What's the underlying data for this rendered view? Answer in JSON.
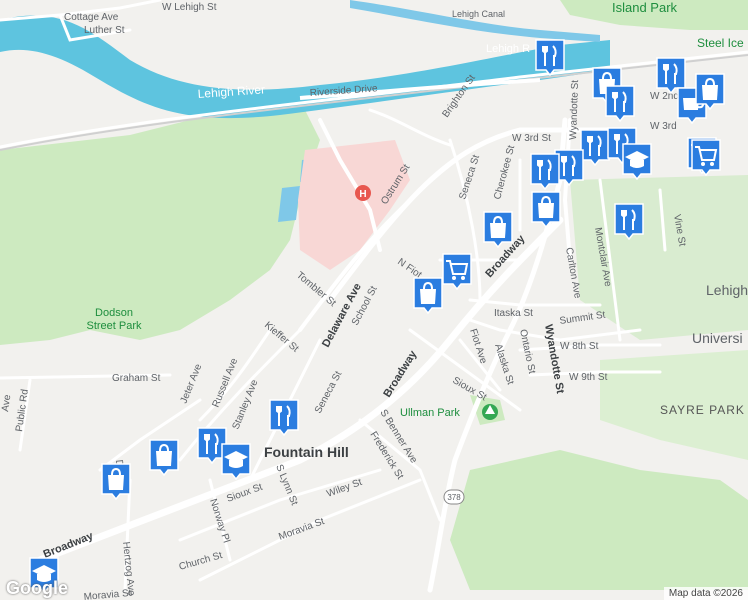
{
  "map": {
    "attribution": "Map data ©2026",
    "logo": "Google",
    "place_labels": {
      "fountain_hill": "Fountain Hill",
      "lehigh_univ_1": "Lehigh",
      "lehigh_univ_2": "Universi",
      "sayre_park": "SAYRE PARK",
      "island_park": "Island Park",
      "steel_ice": "Steel Ice",
      "dodson_park_1": "Dodson",
      "dodson_park_2": "Street Park",
      "ullman_park": "Ullman Park",
      "lehigh_river": "Lehigh River",
      "lehigh_river_2": "Lehigh R",
      "lehigh_canal": "Lehigh Canal"
    },
    "streets": {
      "w_lehigh": "W Lehigh St",
      "cottage": "Cottage Ave",
      "luther": "Luther St",
      "riverside": "Riverside Drive",
      "brighton": "Brighton St",
      "w3rd": "W 3rd St",
      "w3rd_b": "W 3rd",
      "w2nd": "W 2nd",
      "ostrum": "Ostrum St",
      "seneca_top": "Seneca St",
      "cherokee": "Cherokee St",
      "wyandotte": "Wyandotte St",
      "wyandotte_top": "Wyandotte St",
      "carlton": "Carlton Ave",
      "montclair": "Montclair Ave",
      "vine": "Vine St",
      "broadway_ne": "Broadway",
      "broadway_mid": "Broadway",
      "broadway_sw": "Broadway",
      "delaware": "Delaware Ave",
      "school": "School St",
      "tombler": "Tombler St",
      "kieffer": "Kieffer St",
      "n_fiot": "N Fiot",
      "itaska": "Itaska St",
      "summit": "Summit St",
      "w8th": "W 8th St",
      "w9th": "W 9th St",
      "fiot_ave": "Fiot Ave",
      "alaska": "Alaska St",
      "ontario": "Ontario St",
      "sioux_e": "Sioux St",
      "sioux_w": "Sioux St",
      "graham": "Graham St",
      "jeter": "Jeter Ave",
      "russell": "Russell Ave",
      "stanley": "Stanley Ave",
      "public_rd": "Public Rd",
      "seneca_low": "Seneca St",
      "s_benner": "S Benner Ave",
      "frederick": "Frederick St",
      "wiley": "Wiley St",
      "s_lynn": "S Lynn St",
      "moravia": "Moravia St",
      "moravia_sw": "Moravia St",
      "norway": "Norway Pl",
      "church": "Church St",
      "hertzog": "Hertzog Ave",
      "route_378": "378",
      "ave_left": "Ave",
      "d_left": "D"
    },
    "colors": {
      "background": "#f2f1ee",
      "park": "#cdeac0",
      "water": "#7fc8e8",
      "river": "#5ec4df",
      "hospital": "#f8d7d5",
      "marker": "#2b7de0",
      "road": "#ffffff"
    }
  },
  "markers": [
    {
      "icon": "restaurant-icon",
      "name": "marker-restaurant-1"
    },
    {
      "icon": "shopping-bag-icon",
      "name": "marker-shopping-1"
    },
    {
      "icon": "restaurant-icon",
      "name": "marker-restaurant-2"
    },
    {
      "icon": "restaurant-icon",
      "name": "marker-restaurant-3"
    },
    {
      "icon": "cafe-icon",
      "name": "marker-cafe-1"
    },
    {
      "icon": "shopping-bag-icon",
      "name": "marker-shopping-2"
    },
    {
      "icon": "restaurant-icon",
      "name": "marker-restaurant-4"
    },
    {
      "icon": "restaurant-icon",
      "name": "marker-restaurant-5"
    },
    {
      "icon": "school-icon",
      "name": "marker-school-1"
    },
    {
      "icon": "shopping-cart-icon",
      "name": "marker-cart-1"
    },
    {
      "icon": "restaurant-icon",
      "name": "marker-restaurant-6"
    },
    {
      "icon": "restaurant-icon",
      "name": "marker-restaurant-7"
    },
    {
      "icon": "shopping-bag-icon",
      "name": "marker-shopping-3"
    },
    {
      "icon": "shopping-bag-icon",
      "name": "marker-shopping-4"
    },
    {
      "icon": "restaurant-icon",
      "name": "marker-restaurant-8"
    },
    {
      "icon": "shopping-cart-icon",
      "name": "marker-cart-2"
    },
    {
      "icon": "shopping-bag-icon",
      "name": "marker-shopping-5"
    },
    {
      "icon": "restaurant-icon",
      "name": "marker-restaurant-9"
    },
    {
      "icon": "shopping-bag-icon",
      "name": "marker-shopping-6"
    },
    {
      "icon": "restaurant-icon",
      "name": "marker-restaurant-10"
    },
    {
      "icon": "school-icon",
      "name": "marker-school-2"
    },
    {
      "icon": "shopping-bag-icon",
      "name": "marker-shopping-7"
    },
    {
      "icon": "school-icon",
      "name": "marker-school-3"
    },
    {
      "icon": "shopping-cart-icon",
      "name": "marker-cart-3"
    }
  ]
}
